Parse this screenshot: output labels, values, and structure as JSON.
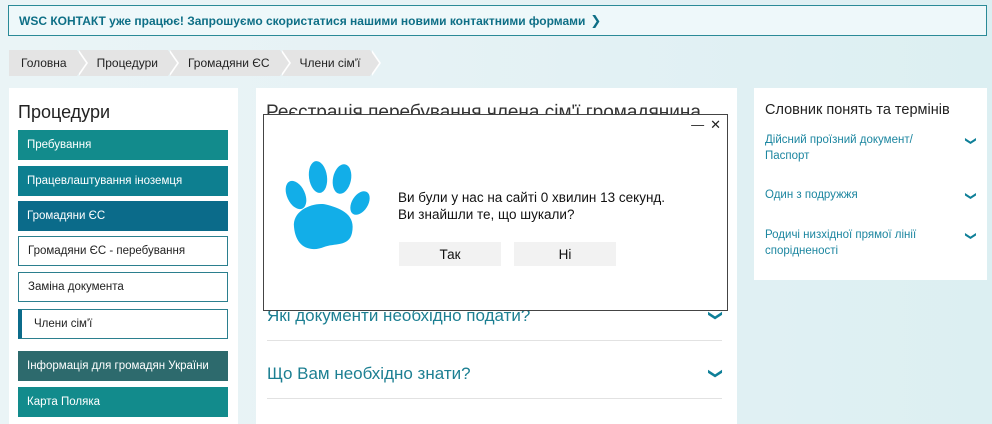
{
  "banner": {
    "text": "WSC КОНТАКТ уже працює! Запрошуємо скористатися нашими новими контактними формами",
    "chevron": "❯"
  },
  "breadcrumb": [
    "Головна",
    "Процедури",
    "Громадяни ЄС",
    "Члени сім'ї"
  ],
  "sidebar": {
    "title": "Процедури",
    "items": [
      {
        "label": "Пребування"
      },
      {
        "label": "Працевлаштування іноземця"
      },
      {
        "label": "Громадяни ЄС"
      },
      {
        "label": "Громадяни ЄС - перебування"
      },
      {
        "label": "Заміна документа"
      },
      {
        "label": "Члени сім'ї"
      },
      {
        "label": "Інформація для громадян України"
      },
      {
        "label": "Карта Поляка"
      }
    ]
  },
  "main": {
    "title": "Реєстрація перебування члена сім'ї громадянина",
    "accordion": [
      {
        "label": "Які документи необхідно подати?"
      },
      {
        "label": "Що Вам необхідно знати?"
      }
    ],
    "chevron": "❯"
  },
  "glossary": {
    "title": "Словник понять та термінів",
    "items": [
      {
        "label": "Дійсний проїзний документ/ Паспорт"
      },
      {
        "label": "Один з подружжя"
      },
      {
        "label": "Родичі низхідної прямої лінії спорідненості"
      }
    ]
  },
  "modal": {
    "line1": "Ви були у нас на сайті 0 хвилин 13 секунд.",
    "line2": "Ви знайшли те, що шукали?",
    "yes": "Так",
    "no": "Ні",
    "minimize": "—",
    "close": "✕",
    "icon": "paw-icon",
    "icon_color": "#12aee8"
  }
}
